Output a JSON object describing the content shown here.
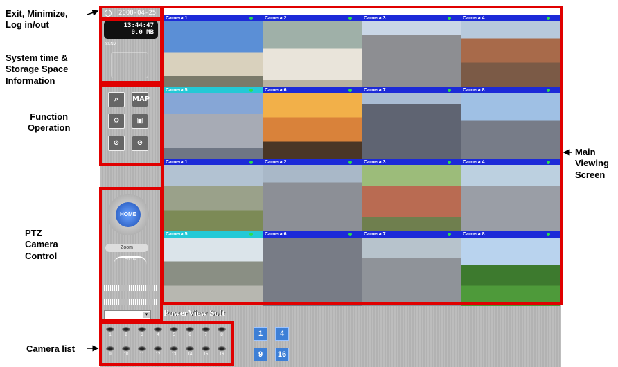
{
  "annotations": {
    "exit": "Exit, Minimize,\nLog in/out",
    "system": "System time &\nStorage Space\nInformation",
    "function": "Function\nOperation",
    "ptz": "PTZ\nCamera\nControl",
    "camlist": "Camera list",
    "main": "Main\nViewing\nScreen"
  },
  "status": {
    "date": "2008-04-25",
    "time": "13:44:47",
    "storage": "0.0 MB",
    "volume": "SLNV"
  },
  "function_buttons": [
    "Search",
    "MAP",
    "Settings",
    "Playback",
    "Record",
    "Snapshot"
  ],
  "ptz": {
    "home_label": "HOME",
    "zoom_label": "Zoom",
    "focus_label": "Focus"
  },
  "app_logo": "PowerView Soft",
  "layout_buttons": [
    "1",
    "4",
    "9",
    "16"
  ],
  "camera_list_numbers": [
    "1",
    "2",
    "3",
    "4",
    "5",
    "6",
    "7",
    "8",
    "9",
    "10",
    "11",
    "12",
    "13",
    "14",
    "15",
    "16"
  ],
  "cameras": [
    {
      "label": "Camera 1",
      "bar": "blue"
    },
    {
      "label": "Camera 2",
      "bar": "blue"
    },
    {
      "label": "Camera 3",
      "bar": "blue"
    },
    {
      "label": "Camera 4",
      "bar": "blue"
    },
    {
      "label": "Camera 5",
      "bar": "cyan"
    },
    {
      "label": "Camera 6",
      "bar": "blue"
    },
    {
      "label": "Camera 7",
      "bar": "blue"
    },
    {
      "label": "Camera 8",
      "bar": "blue"
    },
    {
      "label": "Camera 1",
      "bar": "blue"
    },
    {
      "label": "Camera 2",
      "bar": "blue"
    },
    {
      "label": "Camera 3",
      "bar": "blue"
    },
    {
      "label": "Camera 4",
      "bar": "blue"
    },
    {
      "label": "Camera 5",
      "bar": "cyan"
    },
    {
      "label": "Camera 6",
      "bar": "blue"
    },
    {
      "label": "Camera 7",
      "bar": "blue"
    },
    {
      "label": "Camera 8",
      "bar": "blue"
    }
  ]
}
